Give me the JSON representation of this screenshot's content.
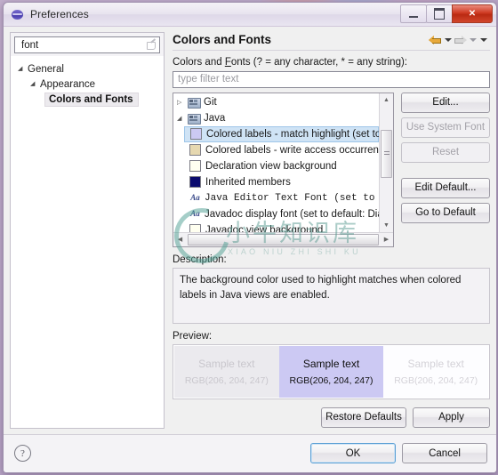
{
  "window": {
    "title": "Preferences",
    "icon": "globe-icon",
    "minimize_label": "Minimize",
    "maximize_label": "Maximize",
    "close_label": "Close"
  },
  "left": {
    "search": {
      "value": "font",
      "placeholder": "type filter text",
      "clear_icon": "clear-icon"
    },
    "tree": [
      {
        "label": "General",
        "level": 1,
        "twisty": "◢",
        "selected": false
      },
      {
        "label": "Appearance",
        "level": 2,
        "twisty": "◢",
        "selected": false
      },
      {
        "label": "Colors and Fonts",
        "level": 3,
        "twisty": "",
        "selected": true
      }
    ]
  },
  "page": {
    "title": "Colors and Fonts",
    "nav": {
      "back_icon": "back-arrow-icon",
      "back_menu_icon": "chevron-down-icon",
      "forward_icon": "forward-arrow-icon",
      "forward_menu_icon": "chevron-down-icon",
      "view_menu_icon": "chevron-down-icon"
    },
    "filter_label_pre": "Colors and ",
    "filter_label_accel": "F",
    "filter_label_post": "onts (? = any character, * = any string):",
    "filter_placeholder": "type filter text",
    "tree": [
      {
        "label": "Git",
        "type": "category",
        "twisty": "▷",
        "icon": "category-icon",
        "selected": false
      },
      {
        "label": "Java",
        "type": "category",
        "twisty": "◢",
        "icon": "category-icon",
        "selected": false
      },
      {
        "label": "Colored labels - match highlight (set to c",
        "type": "color",
        "swatch": "#ccc9f3",
        "selected": true
      },
      {
        "label": "Colored labels - write access occurrences",
        "type": "color",
        "swatch": "#e6d8b0",
        "selected": false
      },
      {
        "label": "Declaration view background",
        "type": "color",
        "swatch": "#fffff0",
        "selected": false
      },
      {
        "label": "Inherited members",
        "type": "color",
        "swatch": "#0b0b6e",
        "selected": false
      },
      {
        "label": "Java Editor Text Font (set to defa",
        "type": "font",
        "icon": "font-icon",
        "selected": false
      },
      {
        "label": "Javadoc display font (set to default: Dial",
        "type": "font",
        "icon": "font-icon",
        "selected": false
      },
      {
        "label": "Javadoc view background",
        "type": "color",
        "swatch": "#fffff0",
        "selected": false
      }
    ],
    "side_buttons": [
      {
        "label": "Edit...",
        "accel": "E",
        "enabled": true
      },
      {
        "label": "Use System Font",
        "accel": "U",
        "enabled": false
      },
      {
        "label": "Reset",
        "accel": "R",
        "enabled": false
      },
      {
        "label": "Edit Default...",
        "accel": "i",
        "enabled": true
      },
      {
        "label": "Go to Default",
        "accel": "G",
        "enabled": true
      }
    ],
    "description_label": "Description:",
    "description_text": "The background color used to highlight matches when colored labels in Java views are enabled.",
    "preview_label": "Preview:",
    "preview_cells": [
      {
        "title": "Sample text",
        "rgb": "RGB(206, 204, 247)",
        "bg": "#ebeaee",
        "state": "dim-left"
      },
      {
        "title": "Sample text",
        "rgb": "RGB(206, 204, 247)",
        "bg": "#ccc9f3",
        "state": "active"
      },
      {
        "title": "Sample text",
        "rgb": "RGB(206, 204, 247)",
        "bg": "#fdfdff",
        "state": "dim-right"
      }
    ],
    "restore_defaults_label": "Restore Defaults",
    "restore_accel": "D",
    "apply_label": "Apply",
    "apply_accel": "A"
  },
  "footer": {
    "help_icon": "help-icon",
    "ok_label": "OK",
    "cancel_label": "Cancel"
  },
  "watermark": {
    "cjk": "小牛知识库",
    "pinyin": "XIAO NIU ZHI SHI KU"
  },
  "colors": {
    "selection": "#cfe3f5",
    "accent_lavender": "#ccc9f3",
    "close_red": "#cf3a22"
  }
}
